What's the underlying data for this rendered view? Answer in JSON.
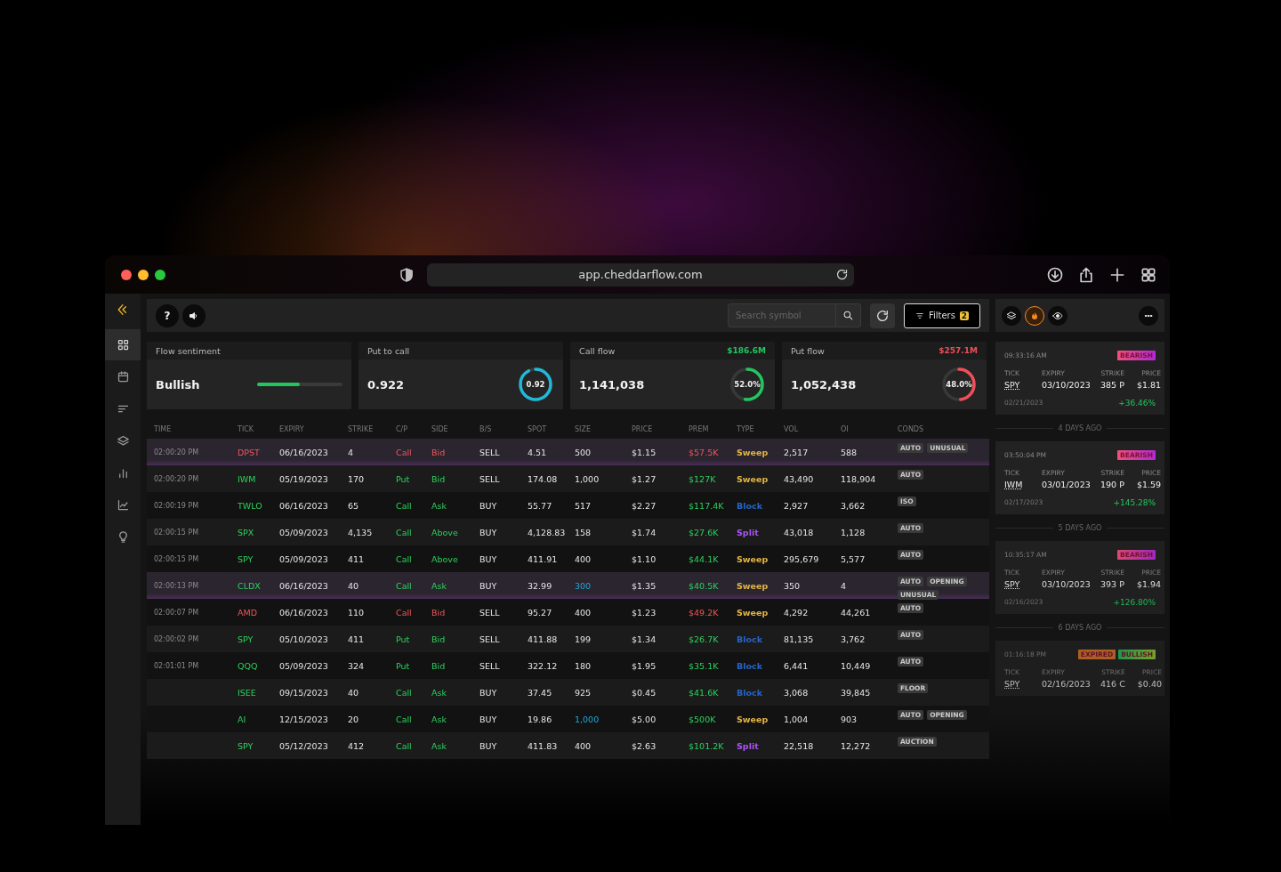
{
  "browser": {
    "url": "app.cheddarflow.com"
  },
  "sidebar": {
    "items": [
      {
        "kind": "grid",
        "selected": true
      },
      {
        "kind": "calendar",
        "selected": false
      },
      {
        "kind": "sort",
        "selected": false
      },
      {
        "kind": "layers",
        "selected": false
      },
      {
        "kind": "bars",
        "selected": false
      },
      {
        "kind": "line",
        "selected": false
      },
      {
        "kind": "bulb",
        "selected": false
      }
    ]
  },
  "toolbar": {
    "help": "?",
    "search": {
      "placeholder": "Search symbol"
    },
    "filters": {
      "label": "Filters",
      "count": "2"
    }
  },
  "stats": [
    {
      "kind": "bar",
      "title": "Flow sentiment",
      "value": "Bullish",
      "level": 0.5,
      "color": "#22c55e"
    },
    {
      "kind": "ring",
      "title": "Put to call",
      "value": "0.922",
      "ring_label": "0.92",
      "color": "#22b8d8"
    },
    {
      "kind": "ring",
      "title": "Call flow",
      "total": "$186.6M",
      "value": "1,141,038",
      "ring_label": "52.0%",
      "color": "#22c55e"
    },
    {
      "kind": "ring",
      "title": "Put flow",
      "total": "$257.1M",
      "value": "1,052,438",
      "ring_label": "48.0%",
      "color": "#ef4e5a"
    }
  ],
  "table": {
    "columns": [
      "TIME",
      "TICK",
      "EXPIRY",
      "STRIKE",
      "C/P",
      "SIDE",
      "B/S",
      "SPOT",
      "SIZE",
      "PRICE",
      "PREM",
      "TYPE",
      "VOL",
      "OI",
      "CONDS"
    ],
    "rows": [
      {
        "time": "02:00:20 PM",
        "tick": "DPST",
        "expiry": "06/16/2023",
        "strike": "4",
        "cp": "Call",
        "side": "Bid",
        "bs": "SELL",
        "spot": "4.51",
        "size": "500",
        "price": "$1.15",
        "prem": "$57.5K",
        "type": "Sweep",
        "vol": "2,517",
        "oi": "588",
        "conds": [
          "AUTO",
          "UNUSUAL"
        ],
        "bearish": true,
        "color": "#e3b341",
        "size_highlight": false,
        "highlighted": true
      },
      {
        "time": "02:00:20 PM",
        "tick": "IWM",
        "expiry": "05/19/2023",
        "strike": "170",
        "cp": "Put",
        "side": "Bid",
        "bs": "SELL",
        "spot": "174.08",
        "size": "1,000",
        "price": "$1.27",
        "prem": "$127K",
        "type": "Sweep",
        "vol": "43,490",
        "oi": "118,904",
        "conds": [
          "AUTO"
        ],
        "bearish": false,
        "color": "#e3b341",
        "size_highlight": false,
        "highlighted": false
      },
      {
        "time": "02:00:19 PM",
        "tick": "TWLO",
        "expiry": "06/16/2023",
        "strike": "65",
        "cp": "Call",
        "side": "Ask",
        "bs": "BUY",
        "spot": "55.77",
        "size": "517",
        "price": "$2.27",
        "prem": "$117.4K",
        "type": "Block",
        "vol": "2,927",
        "oi": "3,662",
        "conds": [
          "ISO"
        ],
        "bearish": false,
        "color": "#2563c8",
        "size_highlight": false,
        "highlighted": false
      },
      {
        "time": "02:00:15 PM",
        "tick": "SPX",
        "expiry": "05/09/2023",
        "strike": "4,135",
        "cp": "Call",
        "side": "Above",
        "bs": "BUY",
        "spot": "4,128.83",
        "size": "158",
        "price": "$1.74",
        "prem": "$27.6K",
        "type": "Split",
        "vol": "43,018",
        "oi": "1,128",
        "conds": [
          "AUTO"
        ],
        "bearish": false,
        "color": "#a855f7",
        "size_highlight": false,
        "highlighted": false
      },
      {
        "time": "02:00:15 PM",
        "tick": "SPY",
        "expiry": "05/09/2023",
        "strike": "411",
        "cp": "Call",
        "side": "Above",
        "bs": "BUY",
        "spot": "411.91",
        "size": "400",
        "price": "$1.10",
        "prem": "$44.1K",
        "type": "Sweep",
        "vol": "295,679",
        "oi": "5,577",
        "conds": [
          "AUTO"
        ],
        "bearish": false,
        "color": "#e3b341",
        "size_highlight": false,
        "highlighted": false
      },
      {
        "time": "02:00:13 PM",
        "tick": "CLDX",
        "expiry": "06/16/2023",
        "strike": "40",
        "cp": "Call",
        "side": "Ask",
        "bs": "BUY",
        "spot": "32.99",
        "size": "300",
        "price": "$1.35",
        "prem": "$40.5K",
        "type": "Sweep",
        "vol": "350",
        "oi": "4",
        "conds": [
          "AUTO",
          "OPENING",
          "UNUSUAL"
        ],
        "bearish": false,
        "color": "#e3b341",
        "size_highlight": true,
        "highlighted": true
      },
      {
        "time": "02:00:07 PM",
        "tick": "AMD",
        "expiry": "06/16/2023",
        "strike": "110",
        "cp": "Call",
        "side": "Bid",
        "bs": "SELL",
        "spot": "95.27",
        "size": "400",
        "price": "$1.23",
        "prem": "$49.2K",
        "type": "Sweep",
        "vol": "4,292",
        "oi": "44,261",
        "conds": [
          "AUTO"
        ],
        "bearish": true,
        "color": "#e3b341",
        "size_highlight": false,
        "highlighted": false
      },
      {
        "time": "02:00:02 PM",
        "tick": "SPY",
        "expiry": "05/10/2023",
        "strike": "411",
        "cp": "Put",
        "side": "Bid",
        "bs": "SELL",
        "spot": "411.88",
        "size": "199",
        "price": "$1.34",
        "prem": "$26.7K",
        "type": "Block",
        "vol": "81,135",
        "oi": "3,762",
        "conds": [
          "AUTO"
        ],
        "bearish": false,
        "color": "#2563c8",
        "size_highlight": false,
        "highlighted": false
      },
      {
        "time": "02:01:01 PM",
        "tick": "QQQ",
        "expiry": "05/09/2023",
        "strike": "324",
        "cp": "Put",
        "side": "Bid",
        "bs": "SELL",
        "spot": "322.12",
        "size": "180",
        "price": "$1.95",
        "prem": "$35.1K",
        "type": "Block",
        "vol": "6,441",
        "oi": "10,449",
        "conds": [
          "AUTO"
        ],
        "bearish": false,
        "color": "#2563c8",
        "size_highlight": false,
        "highlighted": false
      },
      {
        "tick": "ISEE",
        "expiry": "09/15/2023",
        "strike": "40",
        "cp": "Call",
        "side": "Ask",
        "bs": "BUY",
        "spot": "37.45",
        "size": "925",
        "price": "$0.45",
        "prem": "$41.6K",
        "type": "Block",
        "vol": "3,068",
        "oi": "39,845",
        "conds": [
          "FLOOR"
        ],
        "bearish": false,
        "color": "#2563c8",
        "size_highlight": false,
        "highlighted": false
      },
      {
        "tick": "AI",
        "expiry": "12/15/2023",
        "strike": "20",
        "cp": "Call",
        "side": "Ask",
        "bs": "BUY",
        "spot": "19.86",
        "size": "1,000",
        "price": "$5.00",
        "prem": "$500K",
        "type": "Sweep",
        "vol": "1,004",
        "oi": "903",
        "conds": [
          "AUTO",
          "OPENING"
        ],
        "bearish": false,
        "color": "#e3b341",
        "size_highlight": true,
        "highlighted": false
      },
      {
        "tick": "SPY",
        "expiry": "05/12/2023",
        "strike": "412",
        "cp": "Call",
        "side": "Ask",
        "bs": "BUY",
        "spot": "411.83",
        "size": "400",
        "price": "$2.63",
        "prem": "$101.2K",
        "type": "Split",
        "vol": "22,518",
        "oi": "12,272",
        "conds": [
          "AUCTION"
        ],
        "bearish": false,
        "color": "#a855f7",
        "size_highlight": false,
        "highlighted": false
      }
    ]
  },
  "panel": {
    "tools": [
      {
        "kind": "layers",
        "selected": false
      },
      {
        "kind": "fire",
        "selected": true
      },
      {
        "kind": "eye",
        "selected": false
      }
    ],
    "feed": [
      {
        "kind": "alert",
        "time": "09:33:16 AM",
        "tags": [
          {
            "label": "BEARISH",
            "kind": "bearish"
          }
        ],
        "headers": [
          "TICK",
          "EXPIRY",
          "STRIKE",
          "PRICE"
        ],
        "tick": "SPY",
        "expiry": "03/10/2023",
        "strike": "385 P",
        "price": "$1.81",
        "date": "02/21/2023",
        "change": "+36.46%"
      },
      {
        "kind": "divider",
        "label": "4 DAYS AGO"
      },
      {
        "kind": "alert",
        "time": "03:50:04 PM",
        "tags": [
          {
            "label": "BEARISH",
            "kind": "bearish"
          }
        ],
        "headers": [
          "TICK",
          "EXPIRY",
          "STRIKE",
          "PRICE"
        ],
        "tick": "IWM",
        "expiry": "03/01/2023",
        "strike": "190 P",
        "price": "$1.59",
        "date": "02/17/2023",
        "change": "+145.28%"
      },
      {
        "kind": "divider",
        "label": "5 DAYS AGO"
      },
      {
        "kind": "alert",
        "time": "10:35:17 AM",
        "tags": [
          {
            "label": "BEARISH",
            "kind": "bearish"
          }
        ],
        "headers": [
          "TICK",
          "EXPIRY",
          "STRIKE",
          "PRICE"
        ],
        "tick": "SPY",
        "expiry": "03/10/2023",
        "strike": "393 P",
        "price": "$1.94",
        "date": "02/16/2023",
        "change": "+126.80%"
      },
      {
        "kind": "divider",
        "label": "6 DAYS AGO"
      },
      {
        "kind": "alert",
        "time": "01:16:18 PM",
        "tags": [
          {
            "label": "EXPIRED",
            "kind": "expired"
          },
          {
            "label": "BULLISH",
            "kind": "bullish"
          }
        ],
        "headers": [
          "TICK",
          "EXPIRY",
          "STRIKE",
          "PRICE"
        ],
        "tick": "SPY",
        "expiry": "02/16/2023",
        "strike": "416 C",
        "price": "$0.40"
      }
    ]
  }
}
